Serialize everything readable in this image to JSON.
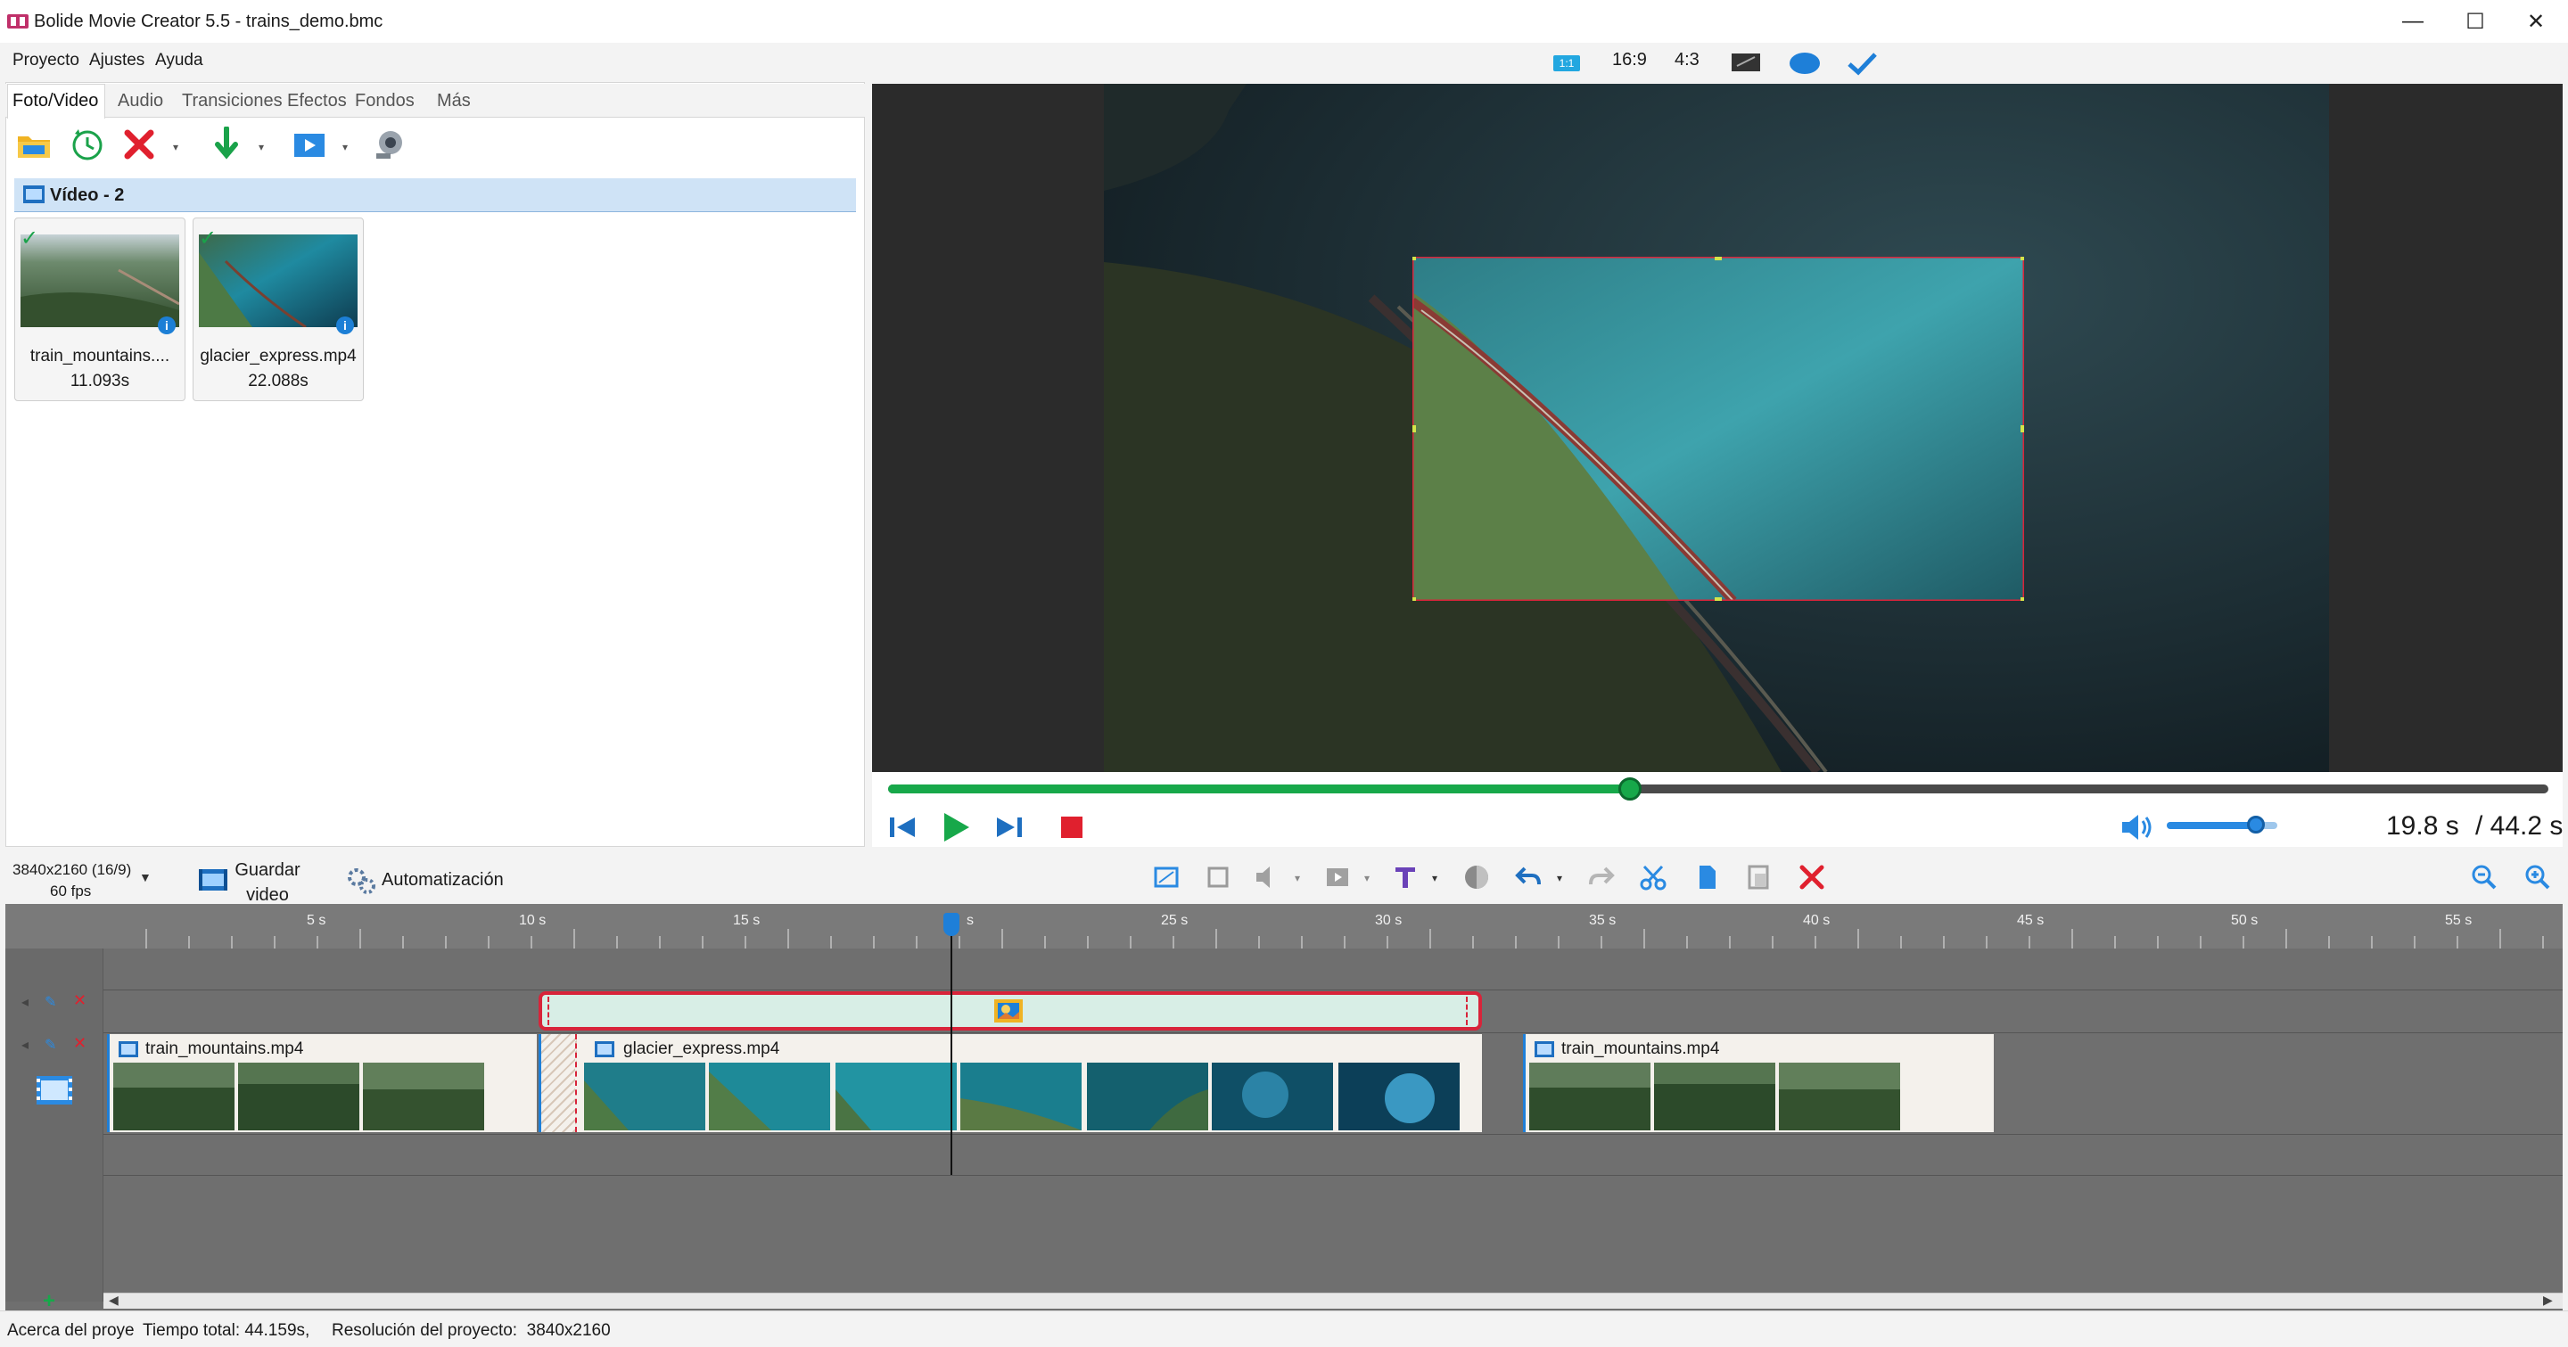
{
  "window": {
    "title": "Bolide Movie Creator 5.5 - trains_demo.bmc",
    "controls": [
      "minimize-icon",
      "maximize-icon",
      "close-icon"
    ]
  },
  "menu": {
    "items": [
      "Proyecto",
      "Ajustes",
      "Ayuda"
    ]
  },
  "aspect": {
    "one_to_one": "1:1",
    "sixteen_nine": "16:9",
    "four_three": "4:3"
  },
  "media_panel": {
    "tabs": [
      "Foto/Video",
      "Audio",
      "Transiciones",
      "Efectos",
      "Fondos",
      "Más"
    ],
    "active_tab": "Foto/Video",
    "toolbar_icons": [
      "open-folder-icon",
      "recent-icon",
      "delete-icon",
      "import-icon",
      "export-icon",
      "webcam-icon"
    ],
    "group_title": "Vídeo - 2",
    "items": [
      {
        "name": "train_mountains....",
        "duration": "11.093s"
      },
      {
        "name": "glacier_express.mp4",
        "duration": "22.088s"
      }
    ]
  },
  "player": {
    "progress": 0.447,
    "volume": 0.8,
    "time_current": "19.8 s",
    "time_total": "/ 44.2 s",
    "buttons": [
      "prev-frame-icon",
      "play-icon",
      "next-frame-icon",
      "stop-icon",
      "volume-icon"
    ]
  },
  "timeline_toolbar": {
    "resolution": "3840x2160 (16/9)",
    "fps": "60 fps",
    "save_label_1": "Guardar",
    "save_label_2": "video",
    "automation": "Automatización",
    "tools": [
      "crop-icon",
      "frame-icon",
      "mute-icon",
      "media-icon",
      "text-icon",
      "color-icon",
      "undo-icon",
      "redo-icon",
      "cut-icon",
      "copy-icon",
      "paste-icon",
      "remove-icon",
      "zoom-out-icon",
      "zoom-in-icon"
    ]
  },
  "timeline": {
    "ticks": [
      "5 s",
      "10 s",
      "15 s",
      "s",
      "25 s",
      "30 s",
      "35 s",
      "40 s",
      "45 s",
      "50 s",
      "55 s"
    ],
    "clips": [
      {
        "name": "train_mountains.mp4"
      },
      {
        "name": "glacier_express.mp4"
      },
      {
        "name": "train_mountains.mp4"
      }
    ]
  },
  "status": {
    "about": "Acerca del proye",
    "total": "Tiempo total: 44.159s,",
    "resolution": "Resolución del proyecto:  3840x2160"
  },
  "colors": {
    "accent_green": "#17a84a",
    "accent_blue": "#1e7fd8",
    "selection_red": "#d8243a"
  }
}
